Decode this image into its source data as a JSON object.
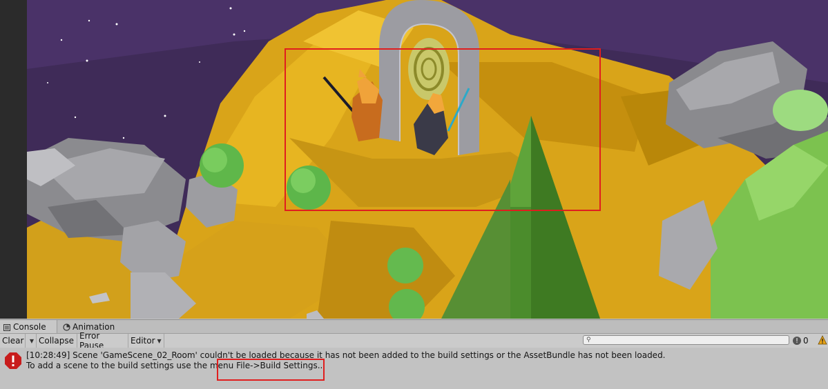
{
  "console": {
    "tabs": [
      {
        "label": "Console",
        "icon": "console-icon"
      },
      {
        "label": "Animation",
        "icon": "animation-icon"
      }
    ],
    "toolbar": {
      "clear_label": "Clear",
      "collapse_label": "Collapse",
      "error_pause_label": "Error Pause",
      "editor_label": "Editor",
      "search_placeholder": "",
      "error_count": "0"
    },
    "log": {
      "line1": "[10:28:49] Scene 'GameScene_02_Room' couldn't be loaded because it has not been added to the build settings or the AssetBundle has not been loaded.",
      "line2": "To add a scene to the build settings use the menu File->Build Settings..."
    }
  },
  "colors": {
    "highlight": "#e01e1e",
    "error_icon": "#c81c1c",
    "warning_icon": "#e8a317"
  }
}
